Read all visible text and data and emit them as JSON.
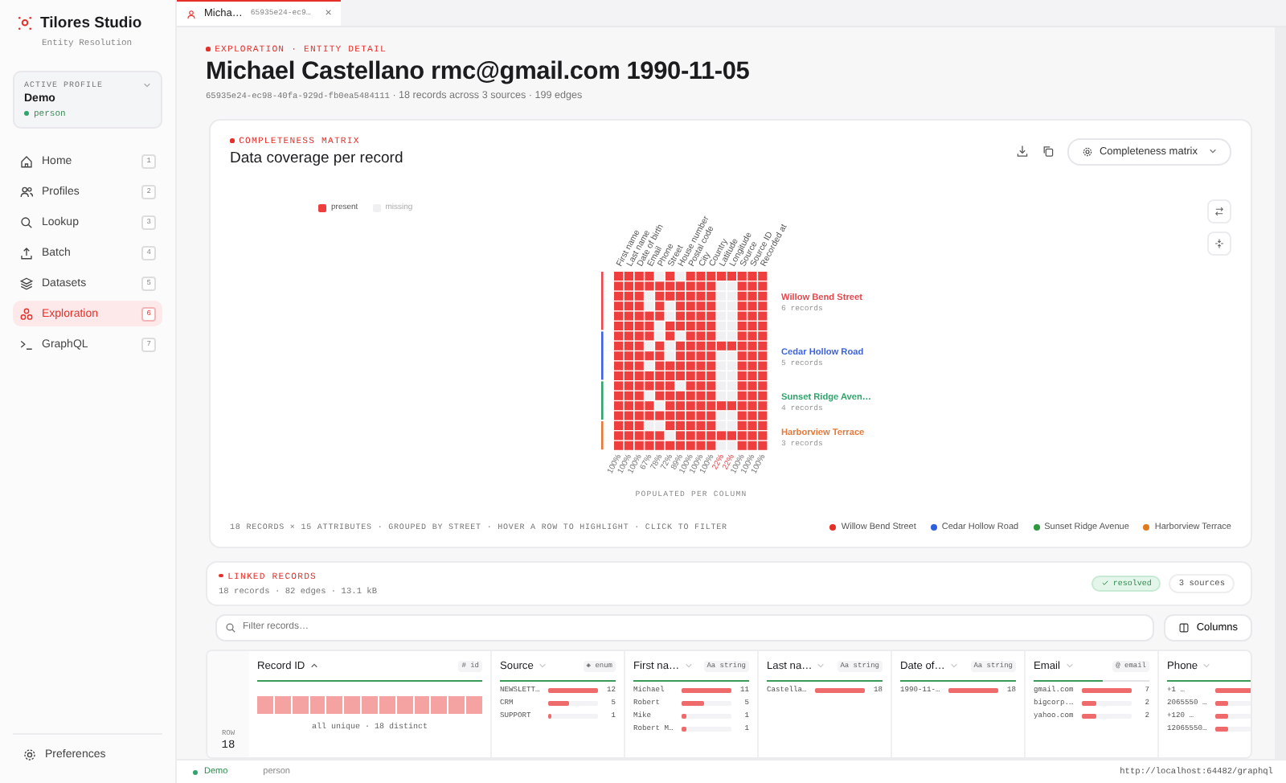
{
  "app": {
    "name": "Tilores Studio",
    "subtitle": "Entity Resolution"
  },
  "profile": {
    "label": "ACTIVE PROFILE",
    "name": "Demo",
    "type": "person"
  },
  "nav": [
    {
      "label": "Home",
      "key": "1",
      "selected": false
    },
    {
      "label": "Profiles",
      "key": "2",
      "selected": false
    },
    {
      "label": "Lookup",
      "key": "3",
      "selected": false
    },
    {
      "label": "Batch",
      "key": "4",
      "selected": false
    },
    {
      "label": "Datasets",
      "key": "5",
      "selected": false
    },
    {
      "label": "Exploration",
      "key": "6",
      "selected": true
    },
    {
      "label": "GraphQL",
      "key": "7",
      "selected": false
    }
  ],
  "preferences": "Preferences",
  "tab": {
    "title": "Micha…",
    "id": "65935e24-ec9…",
    "close": "×"
  },
  "header": {
    "kicker": "EXPLORATION · ENTITY DETAIL",
    "title": "Michael Castellano rmc@gmail.com 1990-11-05",
    "id": "65935e24-ec98-40fa-929d-fb0ea5484111",
    "meta": "· 18 records across 3 sources · 199 edges"
  },
  "matrix": {
    "kicker": "COMPLETENESS MATRIX",
    "title": "Data coverage per record",
    "view": "Completeness matrix",
    "legend_present": "present",
    "legend_missing": "missing",
    "axis_label": "POPULATED PER COLUMN",
    "columns": [
      {
        "label": "First name",
        "populated": "100%",
        "low": false
      },
      {
        "label": "Last name",
        "populated": "100%",
        "low": false
      },
      {
        "label": "Date of birth",
        "populated": "100%",
        "low": false
      },
      {
        "label": "Email",
        "populated": "67%",
        "low": false
      },
      {
        "label": "Phone",
        "populated": "78%",
        "low": false
      },
      {
        "label": "Street",
        "populated": "72%",
        "low": false
      },
      {
        "label": "House number",
        "populated": "89%",
        "low": false
      },
      {
        "label": "Postal code",
        "populated": "100%",
        "low": false
      },
      {
        "label": "City",
        "populated": "100%",
        "low": false
      },
      {
        "label": "Country",
        "populated": "100%",
        "low": false
      },
      {
        "label": "Latitude",
        "populated": "22%",
        "low": true
      },
      {
        "label": "Longitude",
        "populated": "22%",
        "low": true
      },
      {
        "label": "Source",
        "populated": "100%",
        "low": false
      },
      {
        "label": "Source ID",
        "populated": "100%",
        "low": false
      },
      {
        "label": "Recorded at",
        "populated": "100%",
        "low": false
      }
    ],
    "groups": [
      {
        "name": "Willow Bend Street",
        "count": "6 records",
        "color": "#e5484d",
        "rows": [
          [
            true,
            true,
            true,
            true,
            false,
            true,
            false,
            true,
            true,
            true,
            true,
            true,
            true,
            true,
            true
          ],
          [
            true,
            true,
            true,
            true,
            true,
            true,
            true,
            true,
            true,
            true,
            false,
            false,
            true,
            true,
            true
          ],
          [
            true,
            true,
            true,
            false,
            true,
            true,
            true,
            true,
            true,
            true,
            false,
            false,
            true,
            true,
            true
          ],
          [
            true,
            true,
            true,
            false,
            true,
            false,
            true,
            true,
            true,
            true,
            false,
            false,
            true,
            true,
            true
          ],
          [
            true,
            true,
            true,
            true,
            true,
            false,
            true,
            true,
            true,
            true,
            false,
            false,
            true,
            true,
            true
          ],
          [
            true,
            true,
            true,
            true,
            false,
            true,
            true,
            true,
            true,
            true,
            false,
            false,
            true,
            true,
            true
          ]
        ]
      },
      {
        "name": "Cedar Hollow Road",
        "count": "5 records",
        "color": "#3e63dd",
        "rows": [
          [
            true,
            true,
            true,
            true,
            false,
            true,
            false,
            true,
            true,
            true,
            false,
            false,
            true,
            true,
            true
          ],
          [
            true,
            true,
            true,
            false,
            true,
            false,
            true,
            true,
            true,
            true,
            true,
            true,
            true,
            true,
            true
          ],
          [
            true,
            true,
            true,
            true,
            true,
            false,
            true,
            true,
            true,
            true,
            false,
            false,
            true,
            true,
            true
          ],
          [
            true,
            true,
            true,
            false,
            true,
            true,
            true,
            true,
            true,
            true,
            false,
            false,
            true,
            true,
            true
          ],
          [
            true,
            true,
            true,
            true,
            true,
            true,
            true,
            true,
            true,
            true,
            false,
            false,
            true,
            true,
            true
          ]
        ]
      },
      {
        "name": "Sunset Ridge Aven…",
        "count": "4 records",
        "color": "#30a46c",
        "rows": [
          [
            true,
            true,
            true,
            true,
            true,
            true,
            false,
            true,
            true,
            true,
            false,
            false,
            true,
            true,
            true
          ],
          [
            true,
            true,
            true,
            false,
            true,
            true,
            true,
            true,
            true,
            true,
            false,
            false,
            true,
            true,
            true
          ],
          [
            true,
            true,
            true,
            true,
            false,
            true,
            true,
            true,
            true,
            true,
            true,
            true,
            true,
            true,
            true
          ],
          [
            true,
            true,
            true,
            true,
            true,
            true,
            true,
            true,
            true,
            true,
            false,
            false,
            true,
            true,
            true
          ]
        ]
      },
      {
        "name": "Harborview Terrace",
        "count": "3 records",
        "color": "#e5793a",
        "rows": [
          [
            true,
            true,
            true,
            false,
            false,
            true,
            true,
            true,
            true,
            true,
            false,
            false,
            true,
            true,
            true
          ],
          [
            true,
            true,
            true,
            true,
            true,
            false,
            true,
            true,
            true,
            true,
            true,
            true,
            true,
            true,
            true
          ],
          [
            true,
            true,
            true,
            true,
            true,
            true,
            true,
            true,
            true,
            true,
            false,
            false,
            true,
            true,
            true
          ]
        ]
      }
    ],
    "footer": "18 RECORDS × 15 ATTRIBUTES · GROUPED BY STREET · HOVER A ROW TO HIGHLIGHT · CLICK TO FILTER",
    "legend": [
      {
        "name": "Willow Bend Street",
        "color": "#e5302a"
      },
      {
        "name": "Cedar Hollow Road",
        "color": "#2f5fe0"
      },
      {
        "name": "Sunset Ridge Avenue",
        "color": "#2d9a3e"
      },
      {
        "name": "Harborview Terrace",
        "color": "#e07a1f"
      }
    ]
  },
  "linked": {
    "kicker": "LINKED RECORDS",
    "meta": "18 records · 82 edges · 13.1 kB",
    "status": "resolved",
    "sources": "3 sources",
    "filter_placeholder": "Filter records…",
    "columns_button": "Columns"
  },
  "table": {
    "row_label": "ROW",
    "row_value": "18",
    "columns": [
      {
        "name": "Record ID",
        "type": "# id",
        "level": 1,
        "kind": "unique",
        "summary": "all unique · 18 distinct"
      },
      {
        "name": "Source",
        "type": "◈ enum",
        "level": 1,
        "kind": "values",
        "values": [
          {
            "text": "NEWSLETT…",
            "count": "12",
            "level": 1
          },
          {
            "text": "CRM",
            "count": "5",
            "level": 0.42
          },
          {
            "text": "SUPPORT",
            "count": "1",
            "level": 0.08
          }
        ]
      },
      {
        "name": "First na…",
        "type": "Aa string",
        "level": 1,
        "kind": "values",
        "values": [
          {
            "text": "Michael",
            "count": "11",
            "level": 1
          },
          {
            "text": "Robert",
            "count": "5",
            "level": 0.45
          },
          {
            "text": "Mike",
            "count": "1",
            "level": 0.09
          },
          {
            "text": "Robert M…",
            "count": "1",
            "level": 0.09
          }
        ]
      },
      {
        "name": "Last na…",
        "type": "Aa string",
        "level": 1,
        "kind": "values",
        "values": [
          {
            "text": "Castella…",
            "count": "18",
            "level": 1
          }
        ]
      },
      {
        "name": "Date of…",
        "type": "Aa string",
        "level": 1,
        "kind": "values",
        "values": [
          {
            "text": "1990-11-…",
            "count": "18",
            "level": 1
          }
        ]
      },
      {
        "name": "Email",
        "type": "@ email",
        "level": 0.6,
        "kind": "values",
        "values": [
          {
            "text": "gmail.com",
            "count": "7",
            "level": 1
          },
          {
            "text": "bigcorp.…",
            "count": "2",
            "level": 0.29
          },
          {
            "text": "yahoo.com",
            "count": "2",
            "level": 0.29
          }
        ]
      },
      {
        "name": "Phone",
        "level": 1,
        "kind": "values",
        "values": [
          {
            "text": "+1 …",
            "level": 1
          },
          {
            "text": "2065550 …",
            "level": 0.2
          },
          {
            "text": "+120 …",
            "level": 0.2
          },
          {
            "text": "12065550…",
            "level": 0.2
          }
        ]
      }
    ]
  },
  "status": {
    "profile": "Demo",
    "type": "person",
    "url": "http://localhost:64482/graphql"
  }
}
